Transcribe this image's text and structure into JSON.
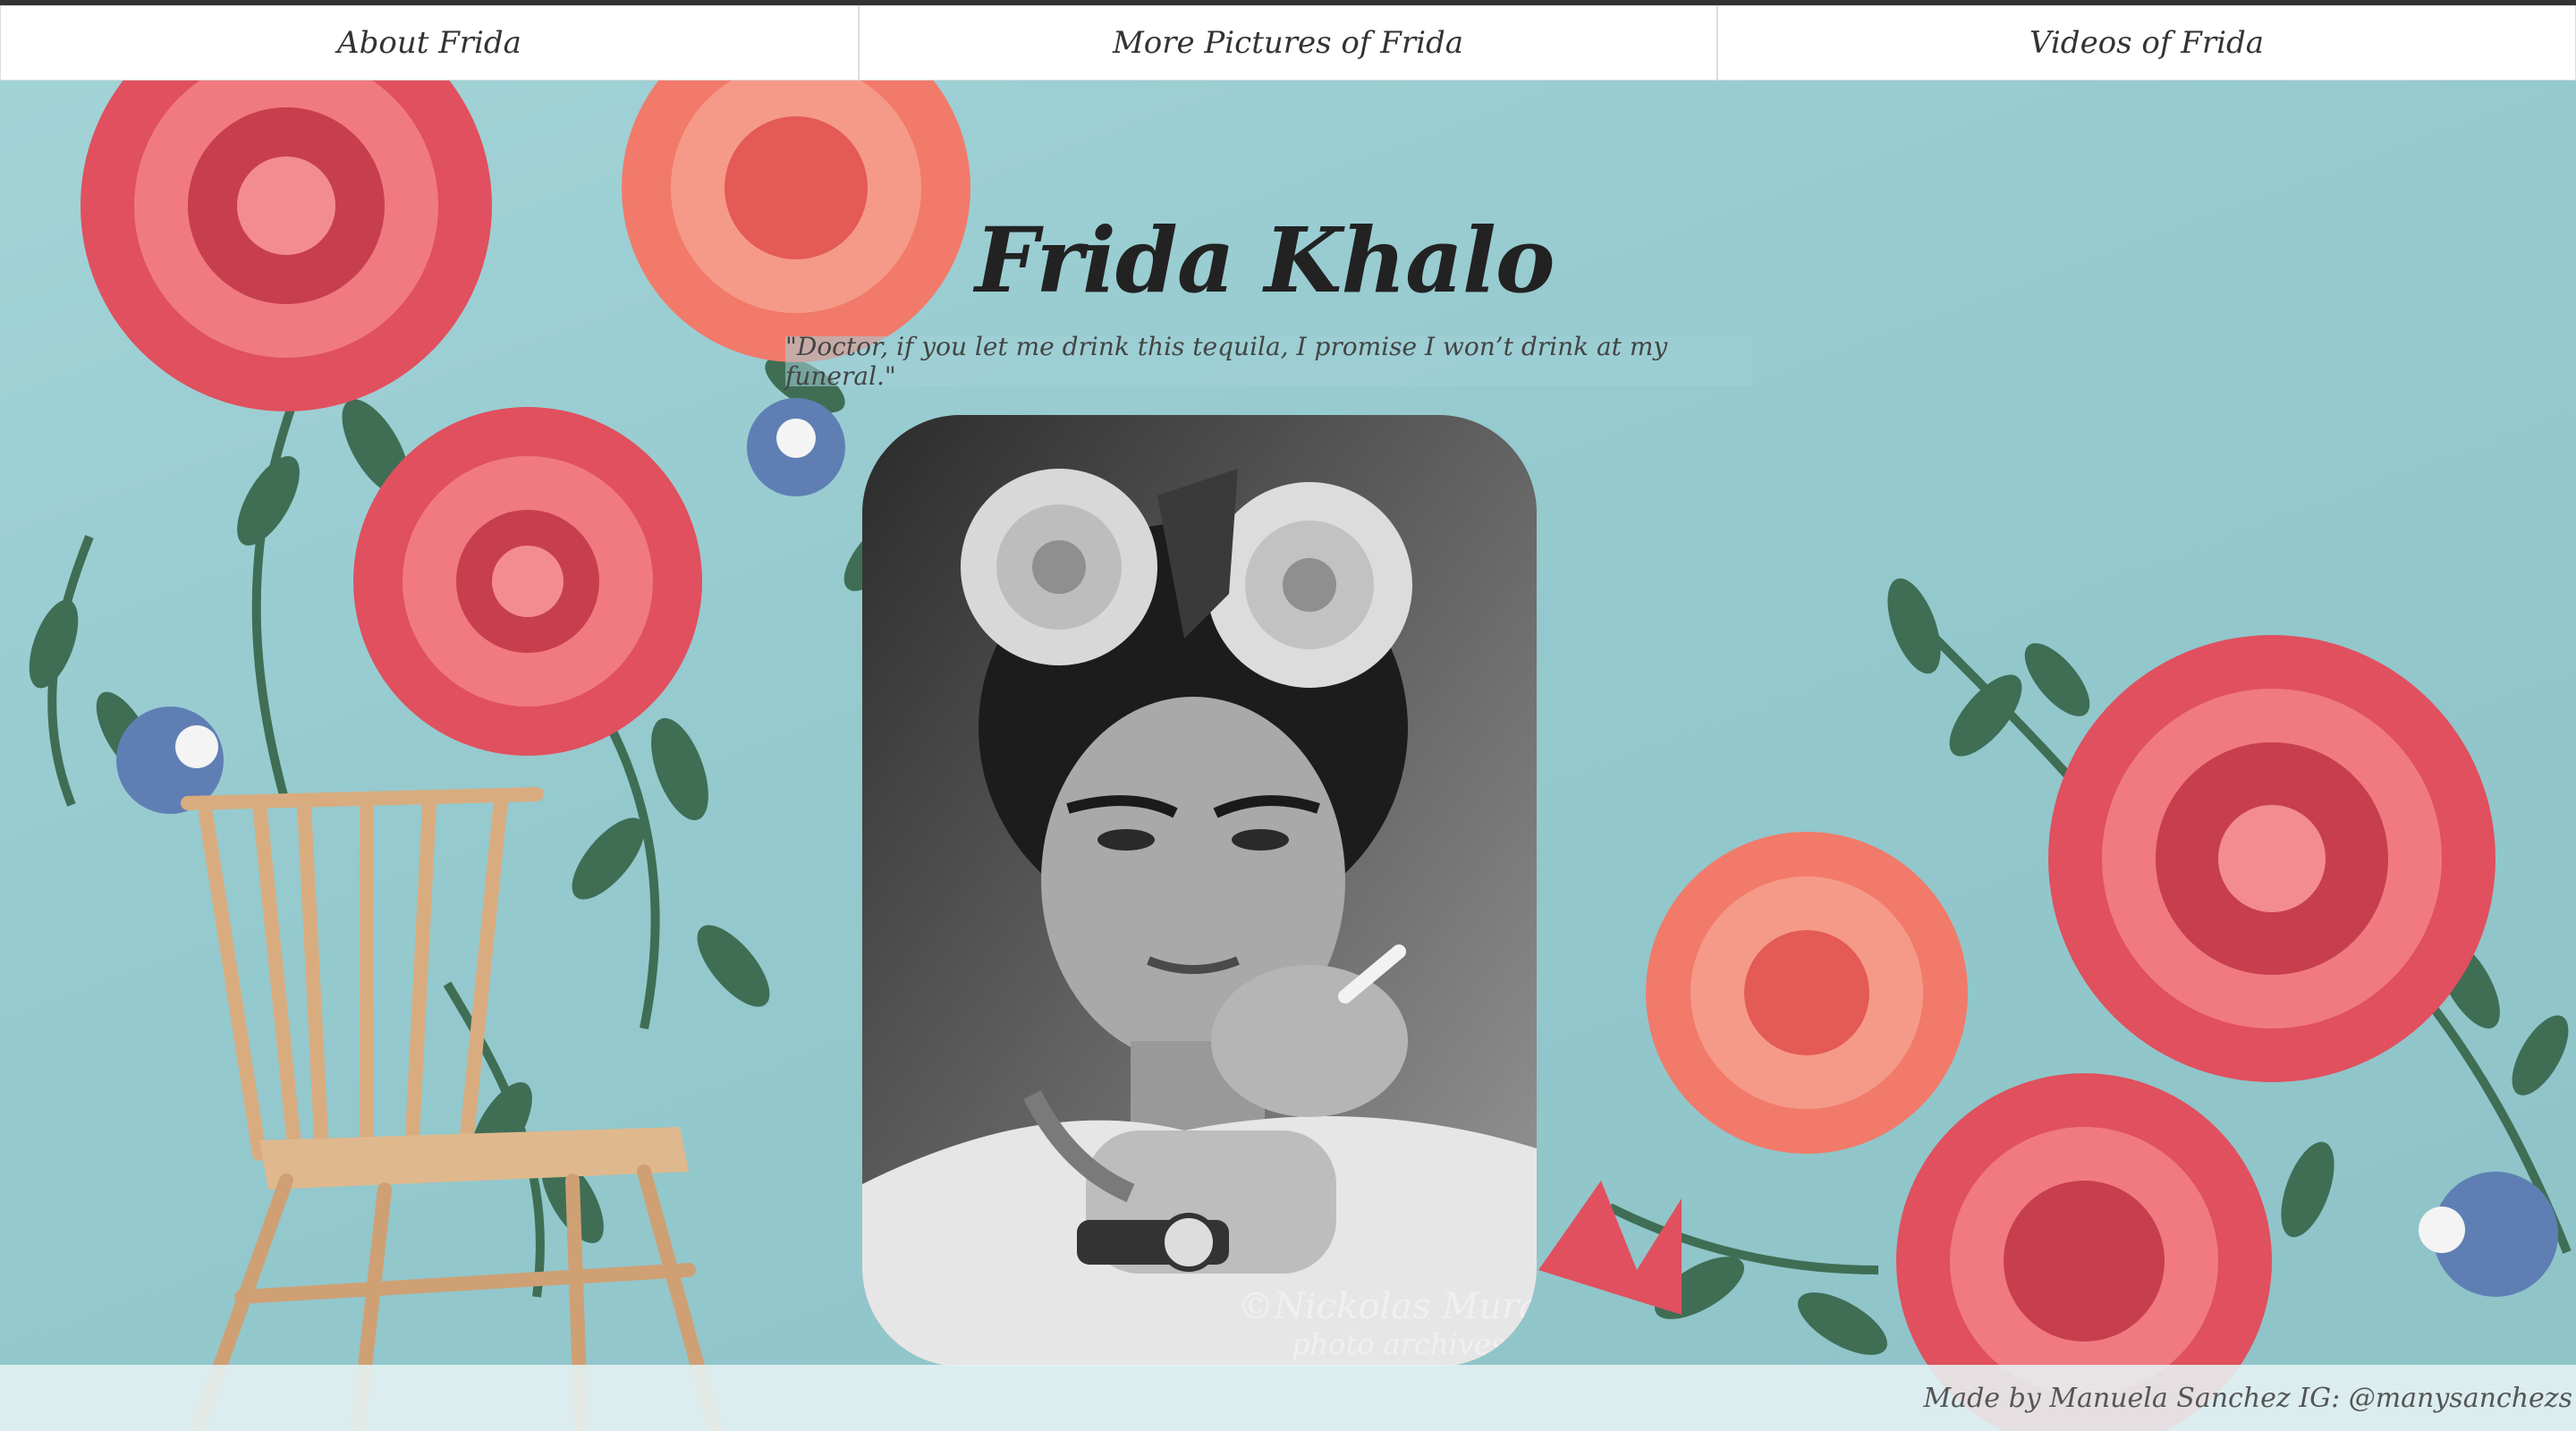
{
  "nav": {
    "items": [
      {
        "label": "About Frida"
      },
      {
        "label": "More Pictures of Frida"
      },
      {
        "label": "Videos of Frida"
      }
    ]
  },
  "header": {
    "title": "Frida Khalo",
    "quote": "\"Doctor, if you let me drink this tequila, I promise I won’t drink at my funeral.\""
  },
  "portrait": {
    "watermark_line1": "©Nickolas Muray",
    "watermark_line2": "photo archives"
  },
  "footer": {
    "credit": "Made by Manuela Sanchez IG: @manysanchezs"
  },
  "colors": {
    "wall": "#9fcfd3",
    "rose": "#e0505e",
    "rose_light": "#f07a80",
    "leaf": "#3f6e55",
    "chair": "#d9ac7f"
  }
}
